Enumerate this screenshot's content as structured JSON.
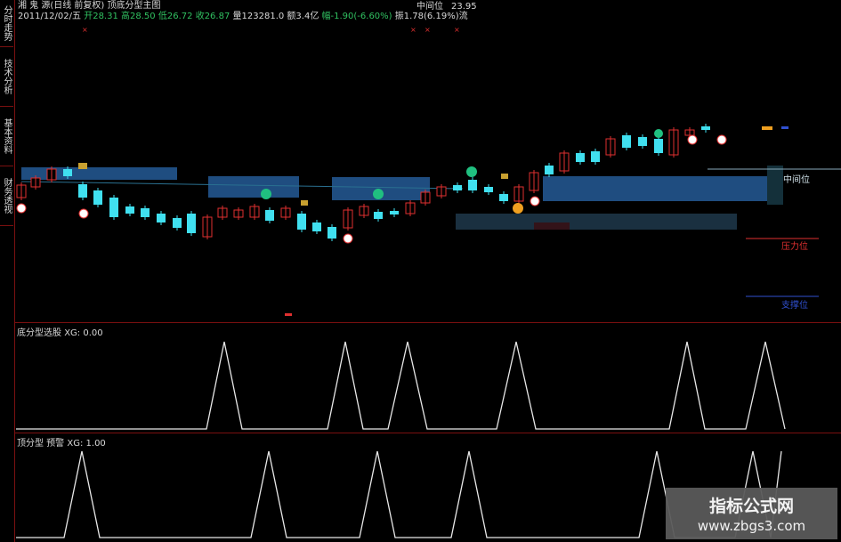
{
  "header": {
    "title": "湘 鬼 源(日线 前复权) 顶底分型主图",
    "date": "2011/12/02/五",
    "open_label": "开",
    "open": "28.31",
    "high_label": "高",
    "high": "28.50",
    "low_label": "低",
    "low": "26.72",
    "close_label": "收",
    "close": "26.87",
    "vol_label": "量",
    "vol": "123281.0",
    "amount_label": "额",
    "amount": "3.4亿",
    "change_label": "幅",
    "change": "-1.90(-6.60%)",
    "amp_label": "振",
    "amp": "1.78(6.19%)",
    "amp_tail": "流",
    "mid_label": "中间位",
    "mid_value": "23.95"
  },
  "sidebar": {
    "tabs": [
      {
        "label": "分时走势"
      },
      {
        "label": "技术分析"
      },
      {
        "label": "基本资料"
      },
      {
        "label": "财务透视"
      }
    ]
  },
  "main": {
    "right_labels": {
      "mid": "中间位",
      "resist": "压力位",
      "support": "支撑位"
    }
  },
  "sub1": {
    "title": "底分型选股",
    "xg": "XG: 0.00"
  },
  "sub2": {
    "title": "顶分型 预警",
    "xg": "XG: 1.00"
  },
  "watermark": {
    "line1": "指标公式网",
    "line2": "www.zbgs3.com"
  },
  "colors": {
    "up": "#e03030",
    "down": "#40e0f0",
    "zone": "#1f4d80",
    "frame": "#7a1010",
    "green_text": "#30c060",
    "red_text": "#e03030"
  }
}
